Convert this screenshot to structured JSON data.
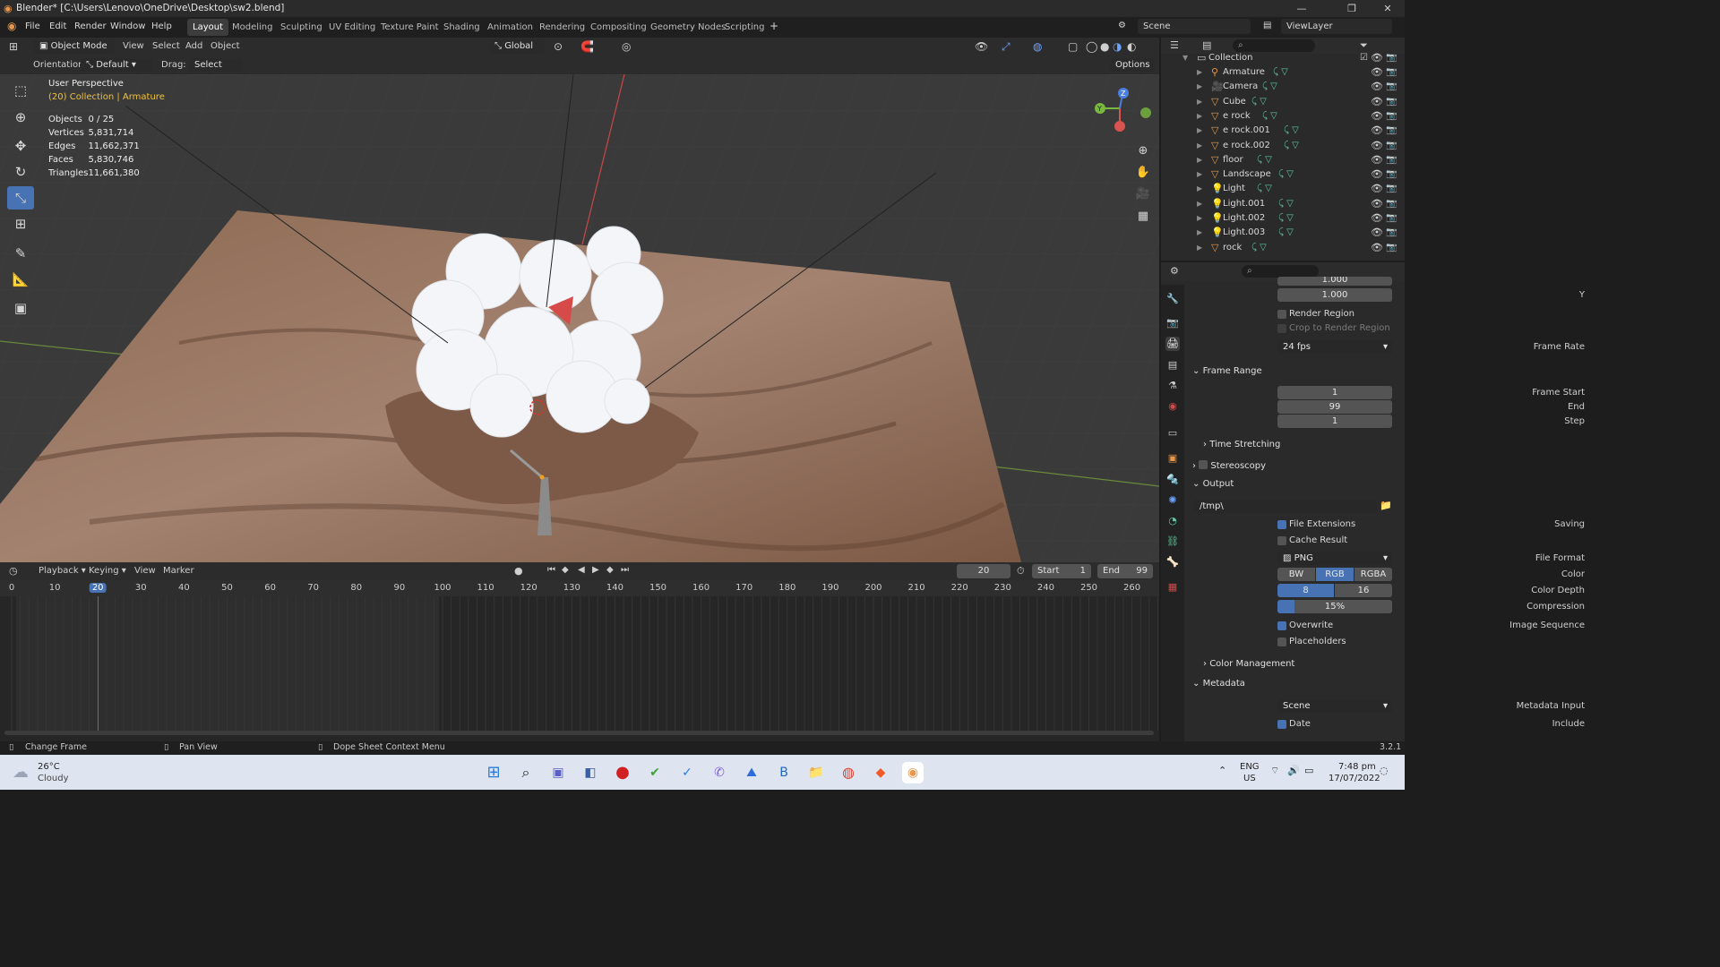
{
  "title": "Blender* [C:\\Users\\Lenovo\\OneDrive\\Desktop\\sw2.blend]",
  "menu": [
    "File",
    "Edit",
    "Render",
    "Window",
    "Help"
  ],
  "workspaces": [
    "Layout",
    "Modeling",
    "Sculpting",
    "UV Editing",
    "Texture Paint",
    "Shading",
    "Animation",
    "Rendering",
    "Compositing",
    "Geometry Nodes",
    "Scripting"
  ],
  "scene": "Scene",
  "view_layer": "ViewLayer",
  "viewport_header": {
    "mode": "Object Mode",
    "items": [
      "View",
      "Select",
      "Add",
      "Object"
    ],
    "transform": "Global",
    "options": "Options"
  },
  "tool_settings": {
    "orientation_label": "Orientation:",
    "orientation": "Default",
    "drag_label": "Drag:",
    "drag": "Select Box"
  },
  "overlay": {
    "perspective": "User Perspective",
    "collection": "(20) Collection | Armature",
    "stats": [
      [
        "Objects",
        "0 / 25"
      ],
      [
        "Vertices",
        "5,831,714"
      ],
      [
        "Edges",
        "11,662,371"
      ],
      [
        "Faces",
        "5,830,746"
      ],
      [
        "Triangles",
        "11,661,380"
      ]
    ]
  },
  "outliner": {
    "collection": "Collection",
    "items": [
      "Armature",
      "Camera",
      "Cube",
      "e rock",
      "e rock.001",
      "e rock.002",
      "floor",
      "Landscape",
      "Light",
      "Light.001",
      "Light.002",
      "Light.003",
      "rock"
    ]
  },
  "properties": {
    "aspect_x": "1.000",
    "aspect_y_label": "Y",
    "aspect_y": "1.000",
    "render_region": "Render Region",
    "crop": "Crop to Render Region",
    "frame_rate_label": "Frame Rate",
    "frame_rate": "24 fps",
    "frame_range": "Frame Range",
    "frame_start_label": "Frame Start",
    "frame_start": "1",
    "end_label": "End",
    "end": "99",
    "step_label": "Step",
    "step": "1",
    "time_stretching": "Time Stretching",
    "stereoscopy": "Stereoscopy",
    "output": "Output",
    "output_path": "/tmp\\",
    "saving_label": "Saving",
    "file_extensions": "File Extensions",
    "cache_result": "Cache Result",
    "file_format_label": "File Format",
    "file_format": "PNG",
    "color_label": "Color",
    "color_opts": [
      "BW",
      "RGB",
      "RGBA"
    ],
    "color_depth_label": "Color Depth",
    "depth_opts": [
      "8",
      "16"
    ],
    "compression_label": "Compression",
    "compression": "15%",
    "compression_value": 0.15,
    "image_sequence_label": "Image Sequence",
    "overwrite": "Overwrite",
    "placeholders": "Placeholders",
    "color_management": "Color Management",
    "metadata": "Metadata",
    "metadata_input_label": "Metadata Input",
    "metadata_input": "Scene",
    "include_label": "Include",
    "date": "Date"
  },
  "timeline": {
    "menus": [
      "Playback",
      "Keying",
      "View",
      "Marker"
    ],
    "current_frame": "20",
    "start_label": "Start",
    "start": "1",
    "end_label": "End",
    "end": "99",
    "ticks": [
      "0",
      "10",
      "20",
      "30",
      "40",
      "50",
      "60",
      "70",
      "80",
      "90",
      "100",
      "110",
      "120",
      "130",
      "140",
      "150",
      "160",
      "170",
      "180",
      "190",
      "200",
      "210",
      "220",
      "230",
      "240",
      "250",
      "260"
    ]
  },
  "status": {
    "change_frame": "Change Frame",
    "pan_view": "Pan View",
    "context_menu": "Dope Sheet Context Menu",
    "version": "3.2.1"
  },
  "taskbar": {
    "temp": "26°C",
    "weather": "Cloudy",
    "lang1": "ENG",
    "lang2": "US",
    "time": "7:48 pm",
    "date": "17/07/2022"
  },
  "colors": {
    "accent": "#4772b3",
    "active_frame": "#4772b3",
    "object_orange": "#e8974a",
    "title_yellow": "#f0c23c"
  }
}
